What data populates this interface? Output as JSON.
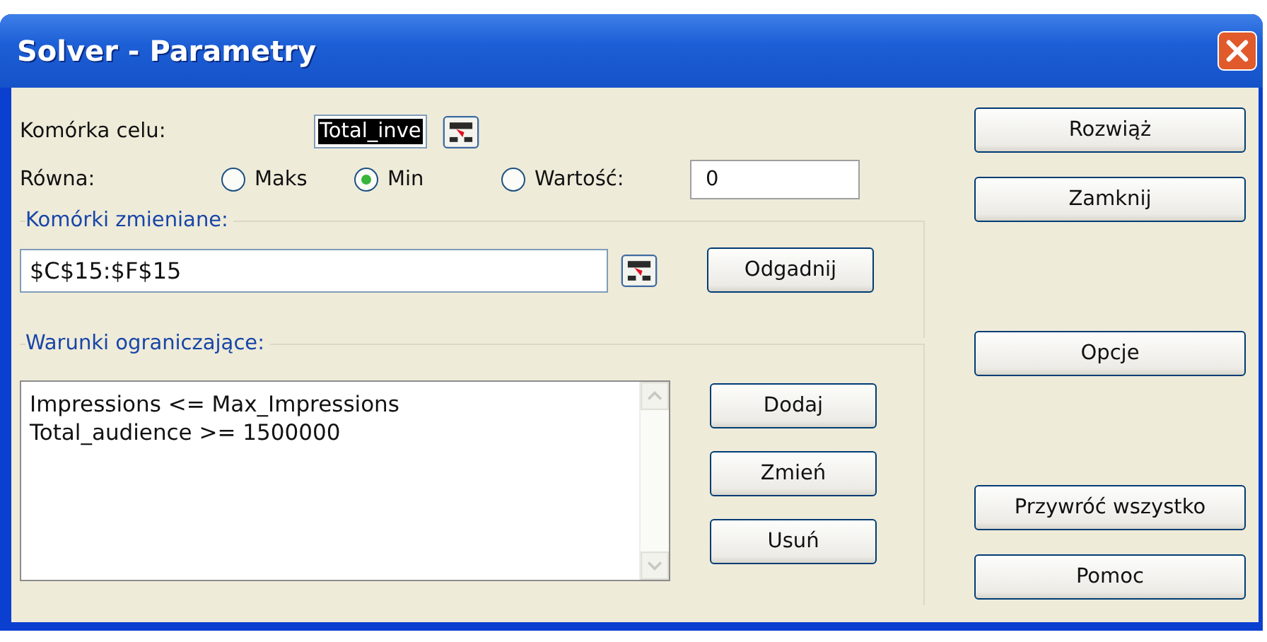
{
  "window": {
    "title": "Solver - Parametry"
  },
  "target_cell": {
    "label": "Komórka celu:",
    "value": "Total_inve"
  },
  "equal_to": {
    "label": "Równa:",
    "options": [
      {
        "label": "Maks",
        "selected": false
      },
      {
        "label": "Min",
        "selected": true
      },
      {
        "label": "Wartość:",
        "selected": false
      }
    ],
    "value": "0"
  },
  "changing_cells": {
    "label": "Komórki zmieniane:",
    "value": "$C$15:$F$15",
    "button": "Odgadnij"
  },
  "constraints": {
    "label": "Warunki ograniczające:",
    "items": [
      "Impressions <= Max_Impressions",
      "Total_audience >= 1500000"
    ],
    "buttons": [
      "Dodaj",
      "Zmień",
      "Usuń"
    ]
  },
  "side_buttons": [
    [
      "Rozwiąż",
      "Zamknij"
    ],
    [
      "Opcje"
    ],
    [
      "Przywróć wszystko",
      "Pomoc"
    ]
  ]
}
